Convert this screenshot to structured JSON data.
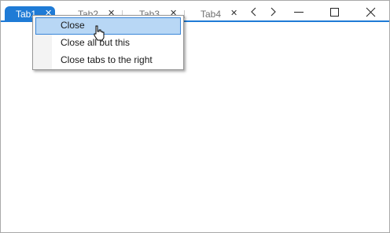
{
  "titlebar": {
    "tabs": [
      {
        "label": "Tab1",
        "close": "✕",
        "active": true
      },
      {
        "label": "Tab2",
        "close": "✕",
        "active": false
      },
      {
        "label": "Tab3",
        "close": "✕",
        "active": false
      },
      {
        "label": "Tab4",
        "close": "✕",
        "active": false
      }
    ],
    "nav": {
      "prev": "‹",
      "next": "›"
    },
    "window_controls": [
      "minimize-icon",
      "maximize-icon",
      "close-icon"
    ]
  },
  "context_menu": {
    "items": [
      {
        "label": "Close",
        "highlighted": true
      },
      {
        "label": "Close all but this",
        "highlighted": false
      },
      {
        "label": "Close tabs to the right",
        "highlighted": false
      }
    ]
  },
  "colors": {
    "accent": "#1f7bd6",
    "menu_highlight": "#b8d7f5",
    "menu_highlight_border": "#3a86d8"
  }
}
